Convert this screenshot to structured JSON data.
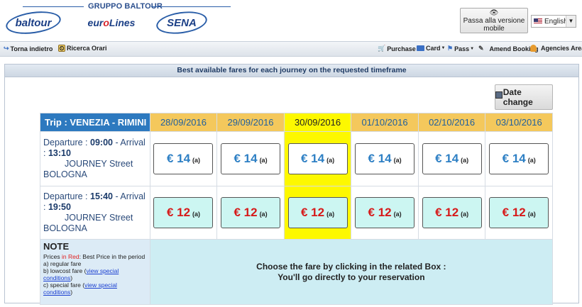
{
  "header": {
    "group_label": "GRUPPO BALTOUR",
    "logos": {
      "baltour": "baltour",
      "eurolines_pre": "eur",
      "eurolines_o": "o",
      "eurolines_post": "Lines",
      "sena": "SENA"
    },
    "mobile_button": {
      "icon": "eye-icon",
      "label": "Passa alla versione mobile"
    },
    "language": {
      "selected": "English",
      "flag": "uk-flag-icon"
    }
  },
  "navbar": {
    "back": "Torna indietro",
    "search": "Ricerca Orari",
    "purchase": "Purchase",
    "card": "Card",
    "pass": "Pass",
    "amend": "Amend Booking",
    "agencies": "Agencies Area"
  },
  "panel": {
    "title": "Best available fares for each journey on the requested timeframe",
    "date_change": "Date change"
  },
  "trip": {
    "title": "Trip : VENEZIA - RIMINI",
    "dates": [
      "28/09/2016",
      "29/09/2016",
      "30/09/2016",
      "01/10/2016",
      "02/10/2016",
      "03/10/2016"
    ],
    "selected_date_index": 2,
    "journeys": [
      {
        "departure_label": "Departure : ",
        "departure_time": "09:00",
        "arrival_label": " - Arrival : ",
        "arrival_time": "13:10",
        "operator": "JOURNEY Street",
        "city": "BOLOGNA",
        "fare_type": "regular",
        "fares": [
          {
            "price": "€ 14",
            "code": "(a)"
          },
          {
            "price": "€ 14",
            "code": "(a)"
          },
          {
            "price": "€ 14",
            "code": "(a)"
          },
          {
            "price": "€ 14",
            "code": "(a)"
          },
          {
            "price": "€ 14",
            "code": "(a)"
          },
          {
            "price": "€ 14",
            "code": "(a)"
          }
        ]
      },
      {
        "departure_label": "Departure : ",
        "departure_time": "15:40",
        "arrival_label": " - Arrival : ",
        "arrival_time": "19:50",
        "operator": "JOURNEY Street",
        "city": "BOLOGNA",
        "fare_type": "best",
        "fares": [
          {
            "price": "€ 12",
            "code": "(a)"
          },
          {
            "price": "€ 12",
            "code": "(a)"
          },
          {
            "price": "€ 12",
            "code": "(a)"
          },
          {
            "price": "€ 12",
            "code": "(a)"
          },
          {
            "price": "€ 12",
            "code": "(a)"
          },
          {
            "price": "€ 12",
            "code": "(a)"
          }
        ]
      }
    ]
  },
  "note": {
    "title": "NOTE",
    "prices_prefix": "Prices ",
    "prices_red": "in Red",
    "prices_suffix": ": Best Price in the period",
    "a": "a) regular fare",
    "b_prefix": "b) lowcost fare (",
    "b_link": "view special conditions",
    "b_suffix": ")",
    "c_prefix": "c) special fare (",
    "c_link": "view special conditions",
    "c_suffix": ")"
  },
  "message": {
    "line1": "Choose the fare by clicking in the related Box :",
    "line2": "You'll go directly to your reservation"
  },
  "colors": {
    "trip_header": "#2d79bf",
    "date_header": "#f4c85c",
    "selected_column": "#fdf800",
    "regular_price": "#2d7fc4",
    "best_price": "#d61a1a",
    "best_box_bg": "#ccf6f2",
    "note_bg": "#dcebf6",
    "message_bg": "#cdedf3"
  }
}
